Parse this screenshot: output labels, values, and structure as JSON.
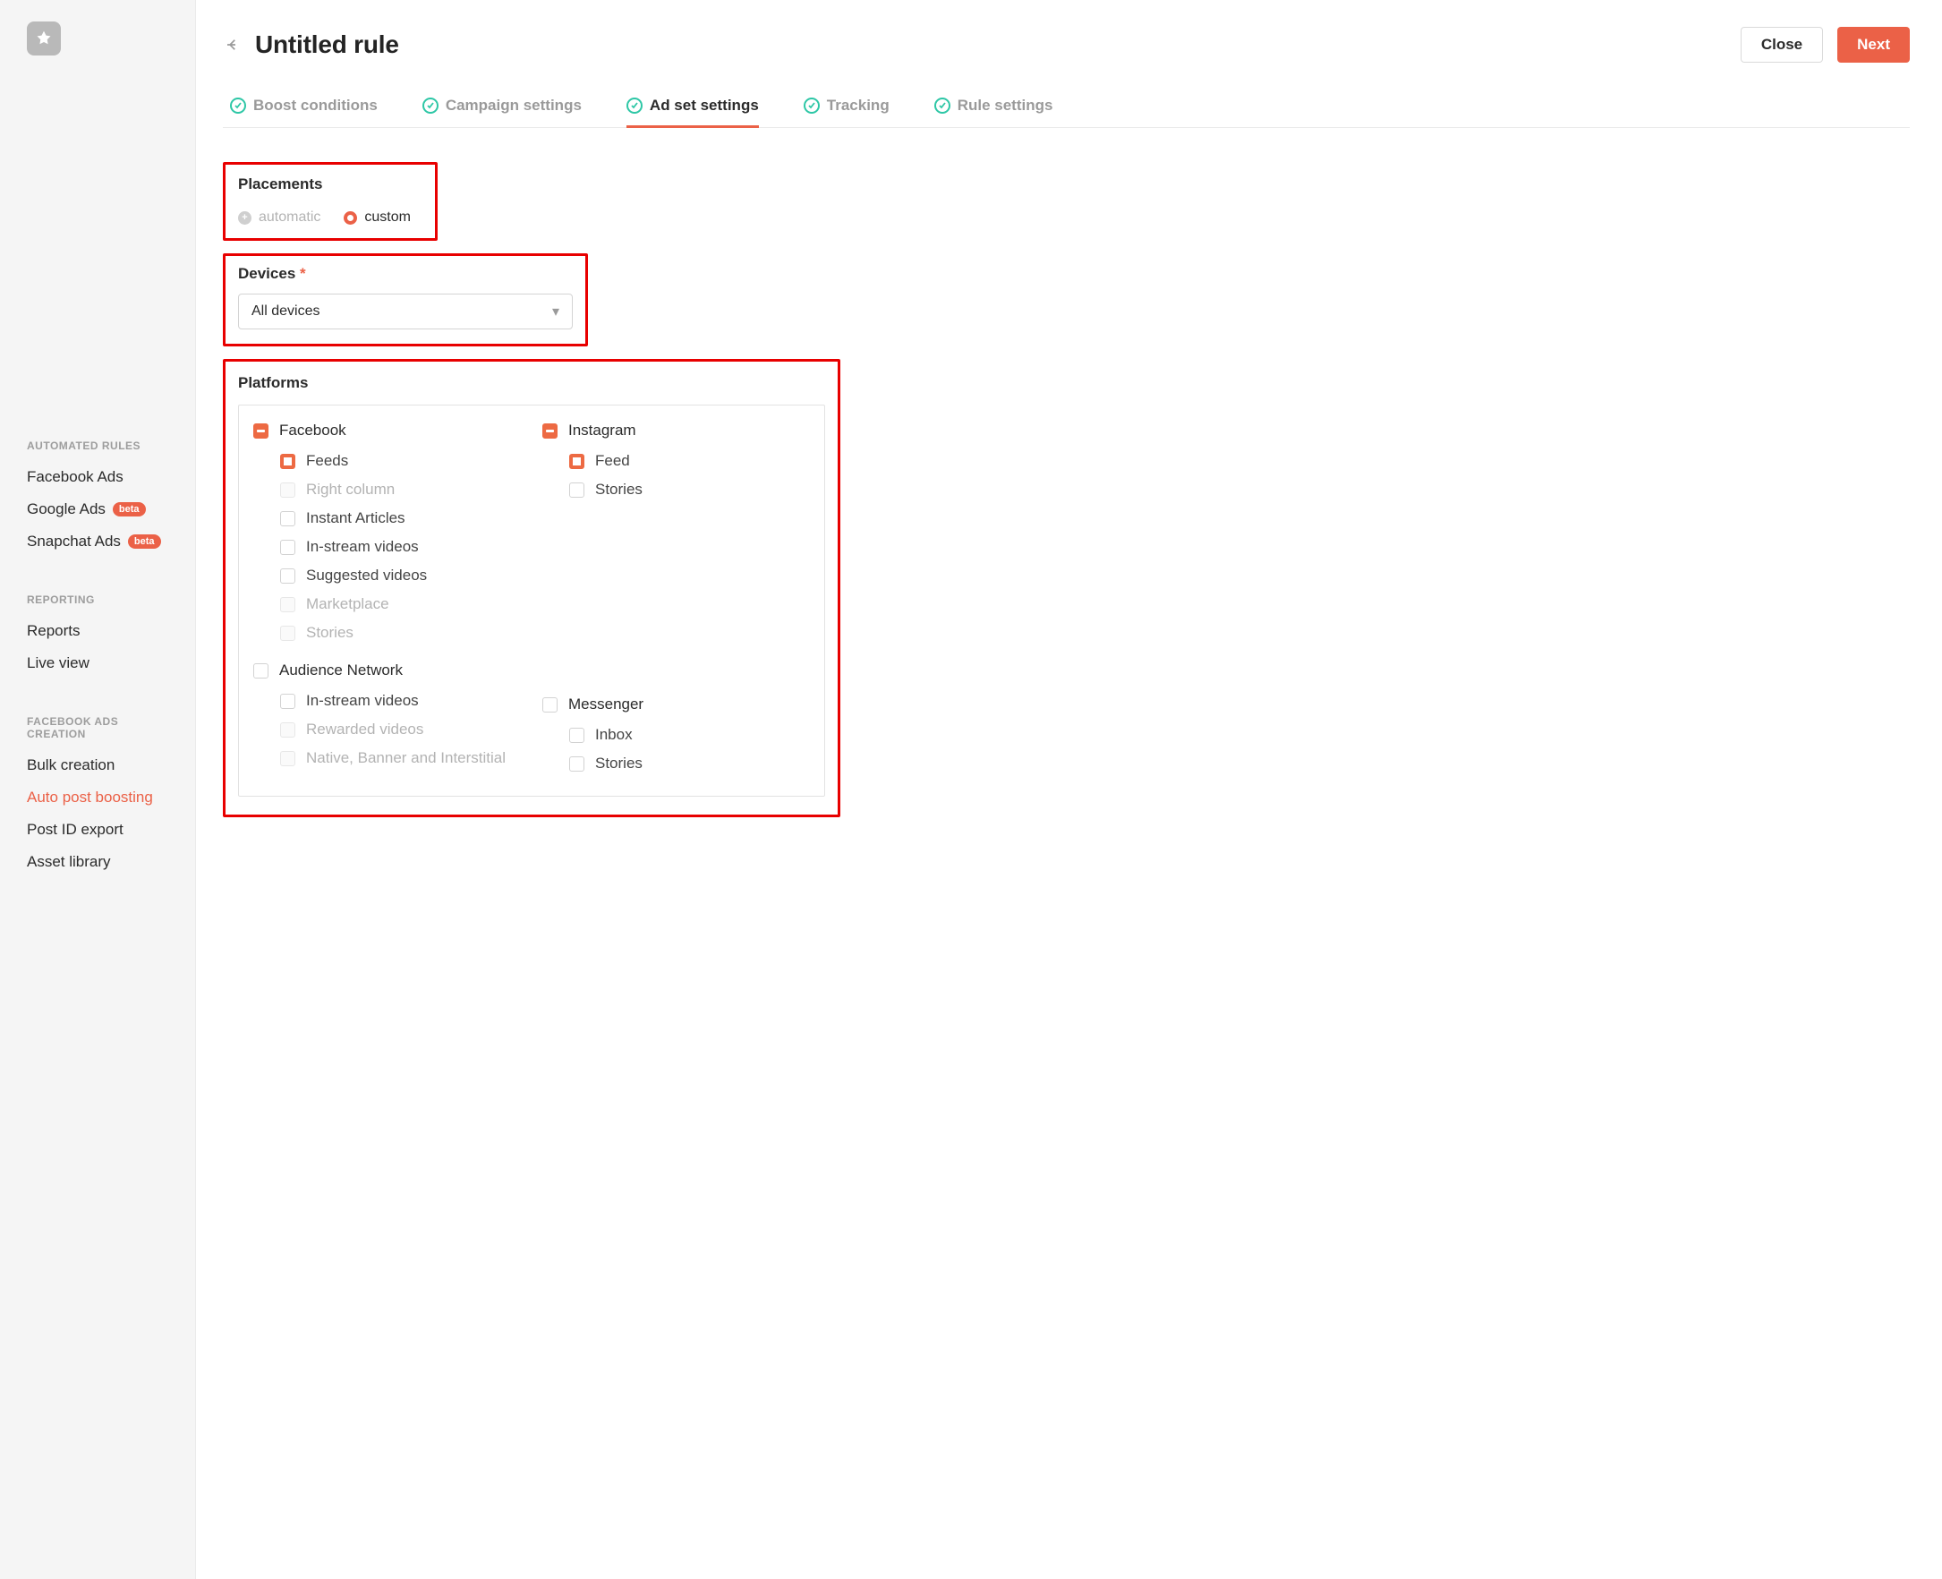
{
  "header": {
    "title": "Untitled rule",
    "close_label": "Close",
    "next_label": "Next"
  },
  "tabs": [
    {
      "label": "Boost conditions"
    },
    {
      "label": "Campaign settings"
    },
    {
      "label": "Ad set settings"
    },
    {
      "label": "Tracking"
    },
    {
      "label": "Rule settings"
    }
  ],
  "sidebar": {
    "sections": {
      "automated_rules": "AUTOMATED RULES",
      "reporting": "REPORTING",
      "fb_ads_creation": "FACEBOOK ADS CREATION"
    },
    "items": {
      "facebook_ads": "Facebook Ads",
      "google_ads": "Google Ads",
      "google_ads_badge": "beta",
      "snapchat_ads": "Snapchat Ads",
      "snapchat_ads_badge": "beta",
      "reports": "Reports",
      "live_view": "Live view",
      "bulk_creation": "Bulk creation",
      "auto_post_boosting": "Auto post boosting",
      "post_id_export": "Post ID export",
      "asset_library": "Asset library"
    }
  },
  "placements": {
    "title": "Placements",
    "options": {
      "automatic": "automatic",
      "custom": "custom"
    },
    "selected": "custom"
  },
  "devices": {
    "title": "Devices",
    "required_mark": "*",
    "value": "All devices"
  },
  "platforms": {
    "title": "Platforms",
    "facebook": {
      "label": "Facebook",
      "items": {
        "feeds": "Feeds",
        "right_column": "Right column",
        "instant_articles": "Instant Articles",
        "in_stream_videos": "In-stream videos",
        "suggested_videos": "Suggested videos",
        "marketplace": "Marketplace",
        "stories": "Stories"
      }
    },
    "instagram": {
      "label": "Instagram",
      "items": {
        "feed": "Feed",
        "stories": "Stories"
      }
    },
    "audience_network": {
      "label": "Audience Network",
      "items": {
        "in_stream_videos": "In-stream videos",
        "rewarded_videos": "Rewarded videos",
        "native_banner_interstitial": "Native, Banner and Interstitial"
      }
    },
    "messenger": {
      "label": "Messenger",
      "items": {
        "inbox": "Inbox",
        "stories": "Stories"
      }
    }
  }
}
